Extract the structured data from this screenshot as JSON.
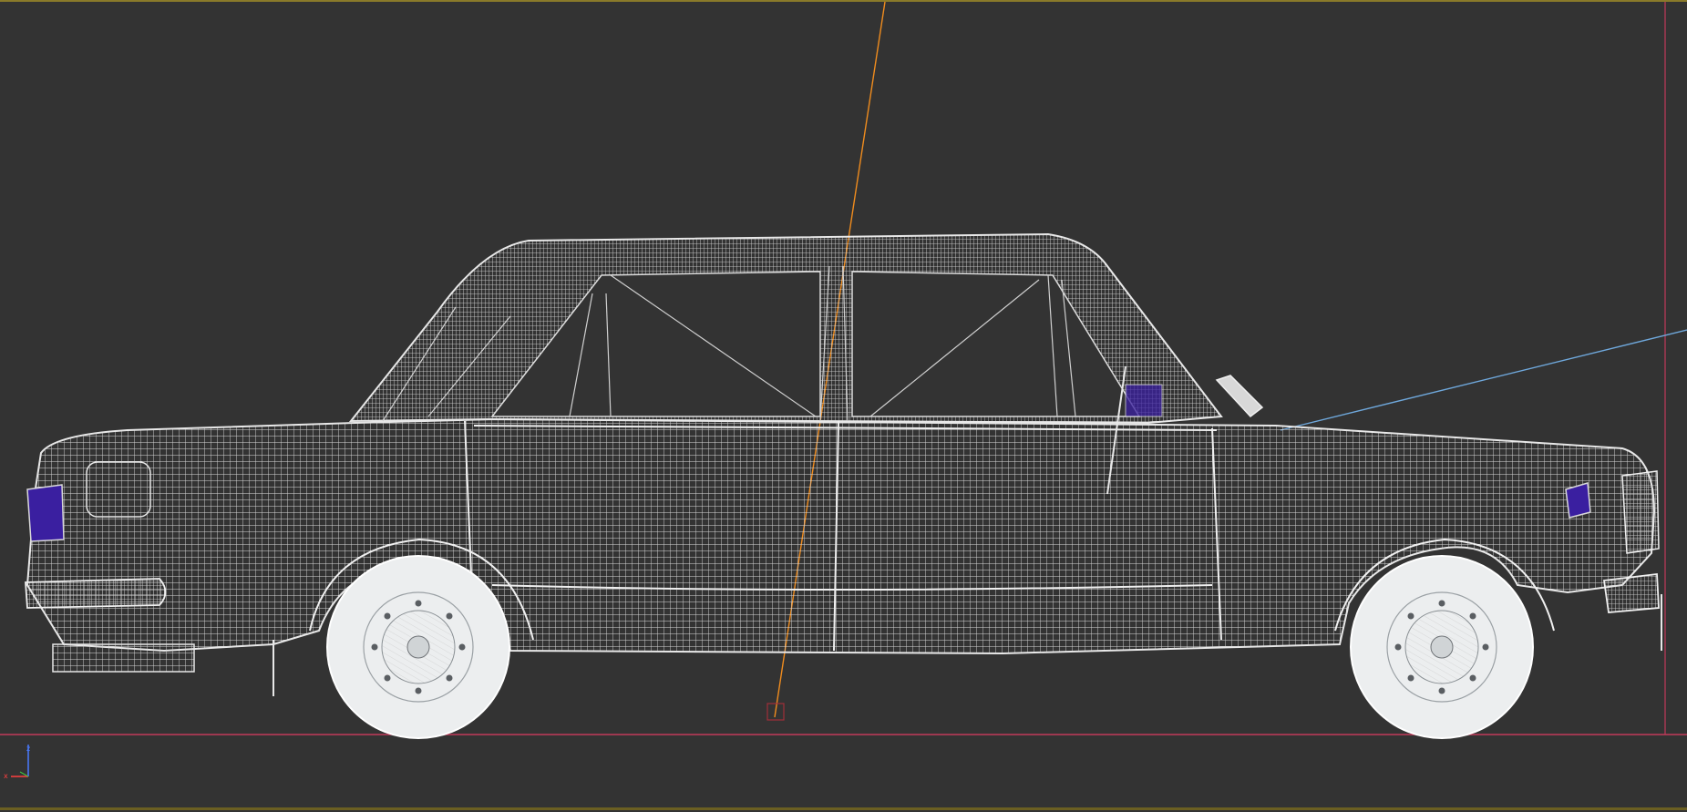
{
  "viewport": {
    "view": "side-orthographic",
    "display_mode": "wireframe",
    "background": "#333333",
    "frame_border_color": "#8a7a2a",
    "wire_color": "#e6e6e6",
    "selection_color": "#3a1fa0",
    "ground_line_color": "#c23a5a",
    "light_direction_color": "#f08c1e",
    "camera_direction_color": "#6fa8dc"
  },
  "model": {
    "object": "sedan-car",
    "parts": [
      "body",
      "roof",
      "front-window",
      "rear-window",
      "front-wheel",
      "rear-wheel",
      "front-bumper",
      "rear-bumper",
      "headlight",
      "taillight",
      "side-mirror",
      "exhaust"
    ]
  },
  "gizmo": {
    "axes": [
      {
        "name": "z",
        "label": "z",
        "color": "#4a7bff"
      },
      {
        "name": "x",
        "label": "x",
        "color": "#ff4040"
      },
      {
        "name": "y",
        "label": "",
        "color": "#40c040"
      }
    ]
  }
}
